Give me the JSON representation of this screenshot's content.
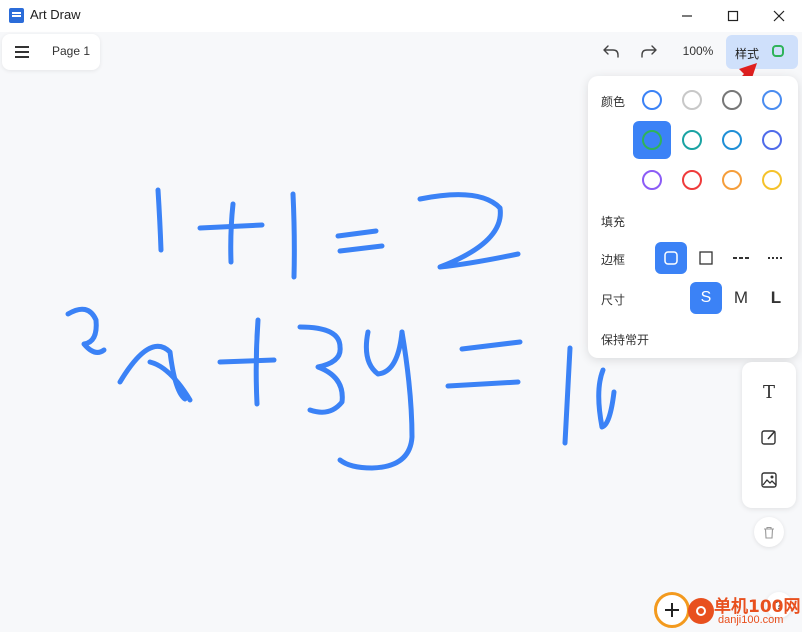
{
  "window": {
    "title": "Art Draw",
    "minimize": "—",
    "maximize": "☐",
    "close": "✕"
  },
  "page_bar": {
    "page_label": "Page 1"
  },
  "toolbar": {
    "undo_icon": "undo-icon",
    "redo_icon": "redo-icon",
    "zoom": "100%",
    "style_label": "样式",
    "style_swatch_color": "#2fb35a"
  },
  "style_panel": {
    "color_label": "颜色",
    "colors": [
      {
        "hex": "#3b82f6",
        "selected": false
      },
      {
        "hex": "#c8c8c8",
        "selected": false
      },
      {
        "hex": "#777777",
        "selected": false
      },
      {
        "hex": "#4a8cf0",
        "selected": false
      },
      {
        "hex": "#2fb35a",
        "selected": true
      },
      {
        "hex": "#1aa3a3",
        "selected": false
      },
      {
        "hex": "#1f8fd6",
        "selected": false
      },
      {
        "hex": "#4f6bea",
        "selected": false
      },
      {
        "hex": "#8b5cf6",
        "selected": false
      },
      {
        "hex": "#ef3b3b",
        "selected": false
      },
      {
        "hex": "#f59e3b",
        "selected": false
      },
      {
        "hex": "#f5c22b",
        "selected": false
      }
    ],
    "fill_label": "填充",
    "border_label": "边框",
    "size_label": "尺寸",
    "size_options": [
      "S",
      "M",
      "L"
    ],
    "size_selected": "S",
    "keep_open_label": "保持常开"
  },
  "side_tools": {
    "text_tool_icon": "T",
    "pen_tool_icon": "pen-icon",
    "image_tool_icon": "image-icon"
  },
  "help_label": "?",
  "watermark": {
    "title": "单机100网",
    "domain": "danji100.com"
  },
  "canvas_drawing": {
    "stroke_color": "#3b82f6"
  }
}
